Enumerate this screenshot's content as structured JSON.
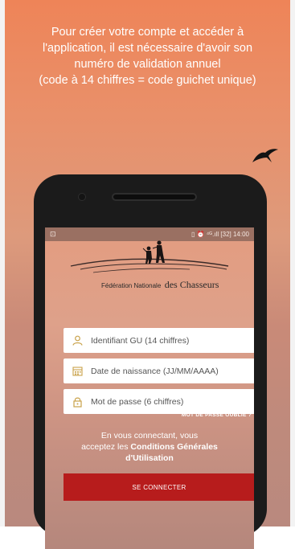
{
  "headline": {
    "line1": "Pour créer votre compte et accéder à",
    "line2": "l'application, il est nécessaire d'avoir son",
    "line3": "numéro de validation annuel",
    "line4": "(code à 14 chiffres = code guichet unique)"
  },
  "status_bar": {
    "left_icon": "image-icon",
    "icons": "▯ ⏰ ⁴ᴳ.ıll",
    "battery": "[32]",
    "time": "14:00"
  },
  "logo": {
    "text_small": "Fédération Nationale",
    "text_big": "des Chasseurs"
  },
  "form": {
    "identifier_placeholder": "Identifiant GU (14 chiffres)",
    "birthdate_placeholder": "Date de naissance (JJ/MM/AAAA)",
    "password_placeholder": "Mot de passe (6 chiffres)",
    "forgot_password": "MOT DE PASSE OUBLIÉ ?",
    "terms_prefix": "En vous connectant, vous",
    "terms_accept": "acceptez les",
    "terms_link_1": "Conditions Générales",
    "terms_link_2": "d'Utilisation",
    "submit_label": "SE CONNECTER"
  },
  "colors": {
    "accent_button": "#b71c1c",
    "icon_tint": "#c9a24a",
    "status_bar": "#9a7062"
  }
}
